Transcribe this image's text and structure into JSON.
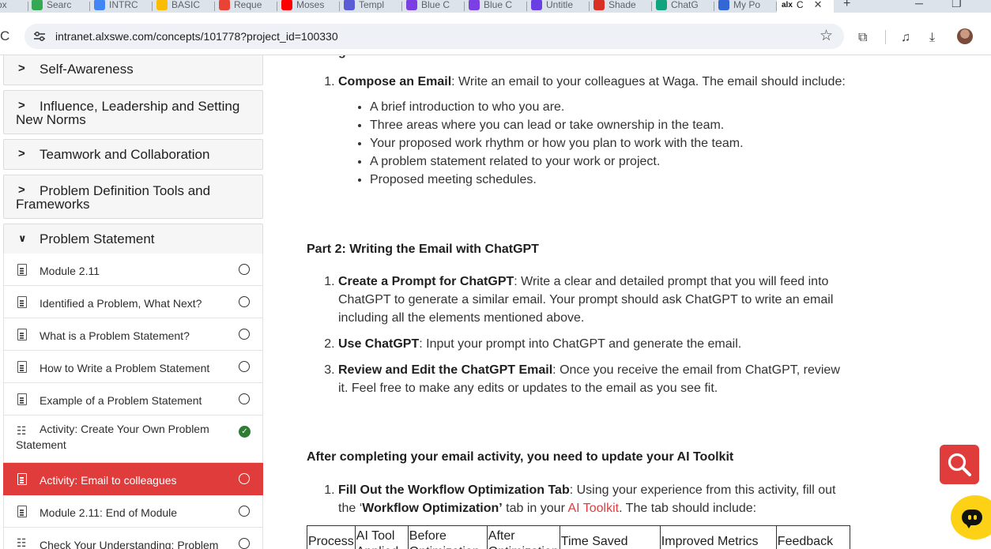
{
  "browser": {
    "tabs": [
      {
        "label": "ox",
        "color": "#5f6368"
      },
      {
        "label": "Searc",
        "color": "#34a853"
      },
      {
        "label": "INTRC",
        "color": "#4285f4"
      },
      {
        "label": "BASIC",
        "color": "#fbbc04"
      },
      {
        "label": "Reque",
        "color": "#ea4335"
      },
      {
        "label": "Moses",
        "color": "#ff0000"
      },
      {
        "label": "Templ",
        "color": "#5b5bd6"
      },
      {
        "label": "Blue C",
        "color": "#7b3fe4"
      },
      {
        "label": "Blue C",
        "color": "#7b3fe4"
      },
      {
        "label": "Untitle",
        "color": "#6a3fe4"
      },
      {
        "label": "Shade",
        "color": "#d93025"
      },
      {
        "label": "ChatG",
        "color": "#10a37f"
      },
      {
        "label": "My Po",
        "color": "#3367d6"
      }
    ],
    "active_tab": {
      "label": "C",
      "favicon_text": "alx"
    },
    "new_tab_symbol": "+",
    "url": "intranet.alxswe.com/concepts/101778?project_id=100330"
  },
  "sidebar": {
    "sections": [
      {
        "label": "Self-Awareness",
        "expanded": false
      },
      {
        "label": "Influence, Leadership and Setting New Norms",
        "expanded": false
      },
      {
        "label": "Teamwork and Collaboration",
        "expanded": false
      },
      {
        "label": "Problem Definition Tools and Frameworks",
        "expanded": false
      },
      {
        "label": "Problem Statement",
        "expanded": true
      }
    ],
    "items": [
      {
        "label": "Module 2.11",
        "icon": "document-icon",
        "status": "incomplete"
      },
      {
        "label": "Identified a Problem, What Next?",
        "icon": "document-icon",
        "status": "incomplete"
      },
      {
        "label": "What is a Problem Statement?",
        "icon": "document-icon",
        "status": "incomplete"
      },
      {
        "label": "How to Write a Problem Statement",
        "icon": "document-icon",
        "status": "incomplete"
      },
      {
        "label": "Example of a Problem Statement",
        "icon": "document-icon",
        "status": "incomplete"
      },
      {
        "label": "Activity: Create Your Own Problem Statement",
        "icon": "checklist-icon",
        "status": "complete"
      },
      {
        "label": "Activity: Email to colleagues",
        "icon": "document-icon",
        "status": "incomplete",
        "active": true
      },
      {
        "label": "Module 2.11: End of Module",
        "icon": "document-icon",
        "status": "incomplete"
      },
      {
        "label": "Check Your Understanding: Problem",
        "icon": "checklist-icon",
        "status": "incomplete"
      }
    ]
  },
  "content": {
    "cut_heading": "g",
    "part1": {
      "item1_bold": "Compose an Email",
      "item1_text": ": Write an email to your colleagues at Waga. The email should include:",
      "bullets": [
        "A brief introduction to who you are.",
        "Three areas where you can lead or take ownership in the team.",
        "Your proposed work rhythm or how you plan to work with the team.",
        "A problem statement related to your work or project.",
        "Proposed meeting schedules."
      ]
    },
    "part2": {
      "heading": "Part 2: Writing the Email with ChatGPT",
      "steps": [
        {
          "bold": "Create a Prompt for ChatGPT",
          "text": ": Write a clear and detailed prompt that you will feed into ChatGPT to generate a similar email. Your prompt should ask ChatGPT to write an email including all the elements mentioned above."
        },
        {
          "bold": "Use ChatGPT",
          "text": ": Input your prompt into ChatGPT and generate the email."
        },
        {
          "bold": "Review and Edit the ChatGPT Email",
          "text": ": Once you receive the email from ChatGPT, review it. Feel free to make any edits or updates to the email as you see fit."
        }
      ]
    },
    "toolkit": {
      "heading": "After completing your email activity, you need to update your AI Toolkit",
      "step_bold": "Fill Out the Workflow Optimization Tab",
      "step_text_1": ": Using your experience from this activity, fill out the ‘",
      "step_bold_2": "Workflow Optimization’",
      "step_text_2": " tab in your ",
      "link": "AI Toolkit",
      "step_text_3": ". The tab should include:",
      "table_headers": [
        "Process",
        "AI Tool Applied",
        "Before Optimization",
        "After Optimization",
        "Time Saved",
        "Improved Metrics",
        "Feedback"
      ]
    }
  }
}
